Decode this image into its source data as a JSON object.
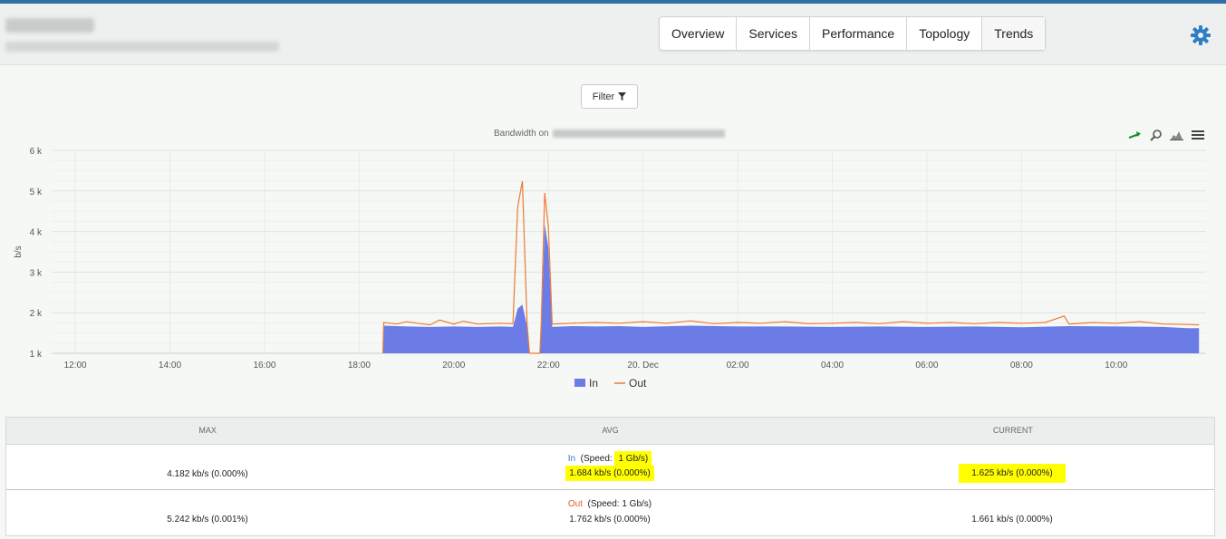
{
  "header": {
    "tabs": [
      "Overview",
      "Services",
      "Performance",
      "Topology",
      "Trends"
    ]
  },
  "filter": {
    "label": "Filter"
  },
  "chart_data": {
    "type": "area",
    "title": "Bandwidth on",
    "ylabel": "b/s",
    "ylim": [
      1000,
      6000
    ],
    "yticks": [
      "6 k",
      "5 k",
      "4 k",
      "3 k",
      "2 k",
      "1 k"
    ],
    "xticks": [
      "12:00",
      "14:00",
      "16:00",
      "18:00",
      "20:00",
      "22:00",
      "20. Dec",
      "02:00",
      "04:00",
      "06:00",
      "08:00",
      "10:00"
    ],
    "legend_position": "bottom",
    "series": [
      {
        "name": "In",
        "color": "#6b7ce6",
        "style": "area",
        "points": [
          [
            18.5,
            1000
          ],
          [
            18.52,
            1680
          ],
          [
            19.0,
            1660
          ],
          [
            19.5,
            1650
          ],
          [
            20.0,
            1660
          ],
          [
            20.5,
            1650
          ],
          [
            21.0,
            1660
          ],
          [
            21.25,
            1650
          ],
          [
            21.35,
            2100
          ],
          [
            21.45,
            2200
          ],
          [
            21.55,
            1660
          ],
          [
            21.6,
            1000
          ],
          [
            21.82,
            1000
          ],
          [
            21.85,
            1700
          ],
          [
            21.92,
            4180
          ],
          [
            22.0,
            3600
          ],
          [
            22.08,
            1650
          ],
          [
            22.5,
            1670
          ],
          [
            23.0,
            1660
          ],
          [
            23.5,
            1670
          ],
          [
            24.0,
            1650
          ],
          [
            25.0,
            1680
          ],
          [
            26.0,
            1660
          ],
          [
            27.0,
            1660
          ],
          [
            28.0,
            1650
          ],
          [
            29.0,
            1660
          ],
          [
            30.0,
            1650
          ],
          [
            31.0,
            1660
          ],
          [
            32.0,
            1640
          ],
          [
            33.0,
            1670
          ],
          [
            34.0,
            1660
          ],
          [
            35.0,
            1650
          ],
          [
            35.5,
            1620
          ],
          [
            35.75,
            1620
          ]
        ]
      },
      {
        "name": "Out",
        "color": "#ee7b36",
        "style": "line",
        "points": [
          [
            18.5,
            1000
          ],
          [
            18.52,
            1760
          ],
          [
            18.8,
            1720
          ],
          [
            19.0,
            1780
          ],
          [
            19.3,
            1730
          ],
          [
            19.5,
            1700
          ],
          [
            19.7,
            1820
          ],
          [
            20.0,
            1720
          ],
          [
            20.2,
            1790
          ],
          [
            20.5,
            1720
          ],
          [
            21.0,
            1740
          ],
          [
            21.25,
            1730
          ],
          [
            21.35,
            4600
          ],
          [
            21.45,
            5240
          ],
          [
            21.55,
            1720
          ],
          [
            21.6,
            1000
          ],
          [
            21.82,
            1000
          ],
          [
            21.85,
            1800
          ],
          [
            21.92,
            4950
          ],
          [
            22.0,
            4100
          ],
          [
            22.08,
            1720
          ],
          [
            22.5,
            1740
          ],
          [
            23.0,
            1760
          ],
          [
            23.5,
            1740
          ],
          [
            24.0,
            1780
          ],
          [
            24.5,
            1740
          ],
          [
            25.0,
            1800
          ],
          [
            25.5,
            1730
          ],
          [
            26.0,
            1760
          ],
          [
            26.5,
            1740
          ],
          [
            27.0,
            1780
          ],
          [
            27.5,
            1730
          ],
          [
            28.0,
            1740
          ],
          [
            28.5,
            1760
          ],
          [
            29.0,
            1730
          ],
          [
            29.5,
            1780
          ],
          [
            30.0,
            1740
          ],
          [
            30.5,
            1760
          ],
          [
            31.0,
            1730
          ],
          [
            31.5,
            1760
          ],
          [
            32.0,
            1740
          ],
          [
            32.5,
            1760
          ],
          [
            32.9,
            1920
          ],
          [
            33.0,
            1720
          ],
          [
            33.5,
            1760
          ],
          [
            34.0,
            1740
          ],
          [
            34.5,
            1780
          ],
          [
            35.0,
            1720
          ],
          [
            35.5,
            1710
          ],
          [
            35.75,
            1700
          ]
        ]
      }
    ]
  },
  "table": {
    "headers": [
      "MAX",
      "AVG",
      "CURRENT"
    ],
    "rows": [
      {
        "label": "In",
        "speed_prefix": "(Speed: ",
        "speed": "1 Gb/s)",
        "max": "4.182 kb/s (0.000%)",
        "avg": "1.684 kb/s (0.000%)",
        "current": "1.625 kb/s (0.000%)"
      },
      {
        "label": "Out",
        "speed_prefix": "(Speed: ",
        "speed": "1 Gb/s)",
        "max": "5.242 kb/s (0.001%)",
        "avg": "1.762 kb/s (0.000%)",
        "current": "1.661 kb/s (0.000%)"
      }
    ]
  },
  "colors": {
    "accent": "#2f6fa3",
    "in": "#6b7ce6",
    "out": "#ee7b36",
    "highlight": "#ffff00"
  }
}
